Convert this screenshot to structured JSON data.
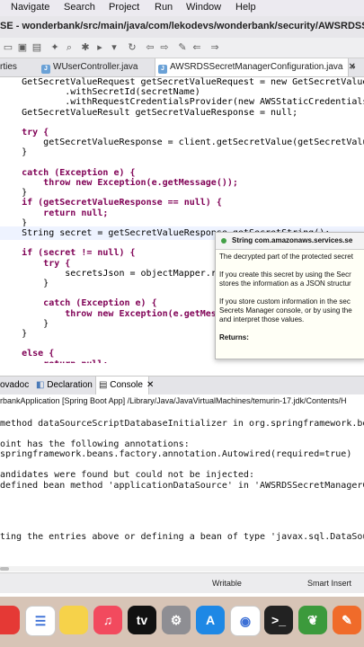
{
  "menu": [
    "Navigate",
    "Search",
    "Project",
    "Run",
    "Window",
    "Help"
  ],
  "window": {
    "title": "SE - wonderbank/src/main/java/com/lekodevs/wonderbank/security/AWSRDSSecretManagerConfiguration.java"
  },
  "editor_tabs": [
    {
      "label": "rties",
      "active": false
    },
    {
      "label": "WUserController.java",
      "active": false
    },
    {
      "label": "AWSRDSSecretManagerConfiguration.java",
      "active": true
    },
    {
      "label": "»",
      "active": false
    }
  ],
  "code_lines": [
    {
      "indent": "    ",
      "text": "GetSecretValueRequest getSecretValueRequest = new GetSecretValueRequest()",
      "style": "plain"
    },
    {
      "indent": "            ",
      "text": ".withSecretId(secretName)",
      "style": "plain"
    },
    {
      "indent": "            ",
      "text": ".withRequestCredentialsProvider(new AWSStaticCredentialsProvider",
      "style": "plain"
    },
    {
      "indent": "    ",
      "text": "GetSecretValueResult getSecretValueResponse = null;",
      "style": "plain"
    },
    {
      "indent": "",
      "text": "",
      "style": "plain"
    },
    {
      "indent": "    ",
      "text": "try {",
      "style": "kw"
    },
    {
      "indent": "        ",
      "text": "getSecretValueResponse = client.getSecretValue(getSecretValueRequest);",
      "style": "plain"
    },
    {
      "indent": "    ",
      "text": "}",
      "style": "plain"
    },
    {
      "indent": "",
      "text": "",
      "style": "plain"
    },
    {
      "indent": "    ",
      "text": "catch (Exception e) {",
      "style": "kw"
    },
    {
      "indent": "        ",
      "text": "throw new Exception(e.getMessage());",
      "style": "kw"
    },
    {
      "indent": "    ",
      "text": "}",
      "style": "plain"
    },
    {
      "indent": "    ",
      "text": "if (getSecretValueResponse == null) {",
      "style": "kw"
    },
    {
      "indent": "        ",
      "text": "return null;",
      "style": "kw"
    },
    {
      "indent": "    ",
      "text": "}",
      "style": "plain"
    },
    {
      "indent": "    ",
      "text": "String secret = getSecretValueResponse.getSecretString();",
      "style": "cursor"
    },
    {
      "indent": "",
      "text": "",
      "style": "plain"
    },
    {
      "indent": "    ",
      "text": "if (secret != null) {",
      "style": "kw"
    },
    {
      "indent": "        ",
      "text": "try {",
      "style": "kw"
    },
    {
      "indent": "            ",
      "text": "secretsJson = objectMapper.read",
      "style": "plain"
    },
    {
      "indent": "        ",
      "text": "}",
      "style": "plain"
    },
    {
      "indent": "",
      "text": "",
      "style": "plain"
    },
    {
      "indent": "        ",
      "text": "catch (Exception e) {",
      "style": "kw"
    },
    {
      "indent": "            ",
      "text": "throw new Exception(e.getMessag",
      "style": "kw"
    },
    {
      "indent": "        ",
      "text": "}",
      "style": "plain"
    },
    {
      "indent": "    ",
      "text": "}",
      "style": "plain"
    },
    {
      "indent": "",
      "text": "",
      "style": "plain"
    },
    {
      "indent": "    ",
      "text": "else {",
      "style": "kw"
    },
    {
      "indent": "        ",
      "text": "return null;",
      "style": "kw"
    }
  ],
  "javadoc_popup": {
    "header": "String com.amazonaws.services.se",
    "lines": [
      "The decrypted part of the protected secret",
      "",
      "If you create this secret by using the Secr",
      "stores the information as a JSON structur",
      "",
      "If you store custom information in the sec",
      "Secrets Manager console, or by using the",
      "and interpret those values.",
      "",
      "Returns:"
    ]
  },
  "view_tabs": [
    {
      "label": "ovadoc",
      "active": false
    },
    {
      "label": "Declaration",
      "active": false
    },
    {
      "label": "Console",
      "active": true
    }
  ],
  "console": {
    "launch": "rbankApplication [Spring Boot App] /Library/Java/JavaVirtualMachines/temurin-17.jdk/Contents/H",
    "lines": [
      "",
      "method dataSourceScriptDatabaseInitializer in org.springframework.boot.",
      "",
      "oint has the following annotations:",
      "springframework.beans.factory.annotation.Autowired(required=true)",
      "",
      "andidates were found but could not be injected:",
      "defined bean method 'applicationDataSource' in 'AWSRDSSecretManagerConf",
      "",
      "",
      "",
      "",
      "ting the entries above or defining a bean of type 'javax.sql.DataSource"
    ]
  },
  "status": {
    "writable": "Writable",
    "insert": "Smart Insert"
  },
  "dock_icons": [
    {
      "name": "app-red-icon",
      "color": "#e53935",
      "glyph": ""
    },
    {
      "name": "reminders-icon",
      "color": "#ffffff",
      "glyph": "☰"
    },
    {
      "name": "notes-icon",
      "color": "#f6d24a",
      "glyph": ""
    },
    {
      "name": "music-icon",
      "color": "#f24a5e",
      "glyph": "♫"
    },
    {
      "name": "apple-tv-icon",
      "color": "#111111",
      "glyph": "tv"
    },
    {
      "name": "system-settings-icon",
      "color": "#8e8e93",
      "glyph": "⚙"
    },
    {
      "name": "app-store-icon",
      "color": "#1e88e5",
      "glyph": "A"
    },
    {
      "name": "chrome-icon",
      "color": "#ffffff",
      "glyph": "◉"
    },
    {
      "name": "terminal-icon",
      "color": "#222222",
      "glyph": ">_"
    },
    {
      "name": "spring-tool-suite-icon",
      "color": "#3c9a3c",
      "glyph": "❦"
    },
    {
      "name": "pen-app-icon",
      "color": "#f06b2a",
      "glyph": "✎"
    }
  ]
}
